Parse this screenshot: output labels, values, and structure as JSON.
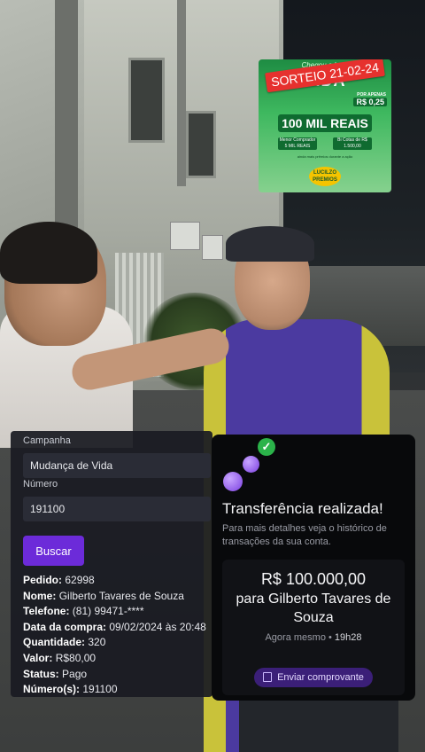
{
  "promo": {
    "script_text": "Chegou a hora",
    "headline_fragment": "VIDA",
    "stamp": "SORTEIO 21-02-24",
    "price_label": "POR APENAS",
    "price": "R$ 0,25",
    "prize": "100 MIL REAIS",
    "box_left": "Menor Comprador 5 MIL REAIS",
    "box_right": "Bi Cotas de R$ 1.500,00",
    "fine_print": "ainda mais prêmios durante a ação",
    "logo": "LUCILZO PREMIOS"
  },
  "lookup": {
    "campaign_label": "Campanha",
    "campaign_value": "Mudança de Vida",
    "number_label": "Número",
    "number_value": "191100",
    "search_button": "Buscar",
    "details": [
      {
        "label": "Pedido:",
        "value": "62998"
      },
      {
        "label": "Nome:",
        "value": "Gilberto Tavares de Souza"
      },
      {
        "label": "Telefone:",
        "value": "(81) 99471-****"
      },
      {
        "label": "Data da compra:",
        "value": "09/02/2024 às 20:48"
      },
      {
        "label": "Quantidade:",
        "value": "320"
      },
      {
        "label": "Valor:",
        "value": "R$80,00"
      },
      {
        "label": "Status:",
        "value": "Pago"
      },
      {
        "label": "Número(s):",
        "value": "191100"
      }
    ]
  },
  "transfer": {
    "title": "Transferência realizada!",
    "subtitle": "Para mais detalhes veja o histórico de transações da sua conta.",
    "amount": "R$ 100.000,00",
    "recipient": "para Gilberto Tavares de Souza",
    "time_prefix": "Agora mesmo",
    "time_sep": " • ",
    "time_value": "19h28",
    "receipt_button": "Enviar comprovante",
    "check_glyph": "✓"
  },
  "colors": {
    "accent_purple": "#6c2bd9",
    "success_green": "#2bb34a",
    "stamp_red": "#e6312e"
  }
}
